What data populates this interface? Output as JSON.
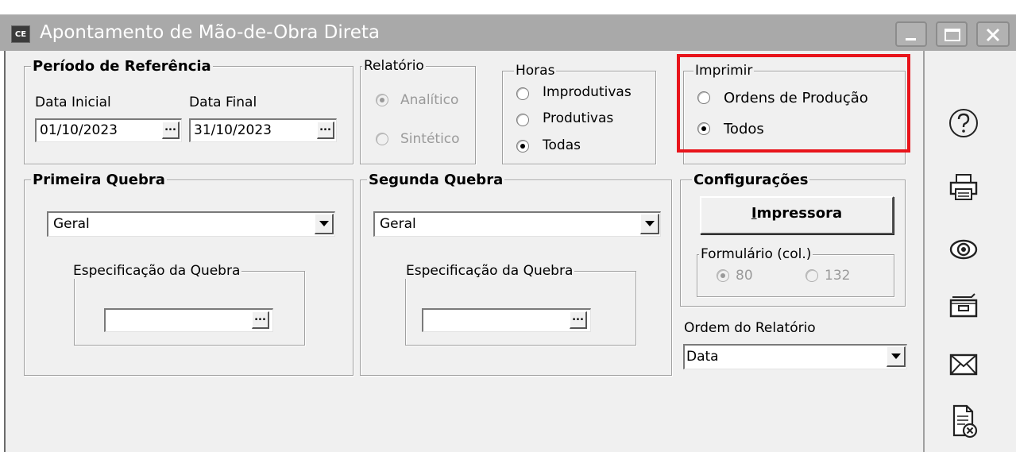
{
  "window": {
    "app_badge": "CE",
    "title": "Apontamento de Mão-de-Obra Direta"
  },
  "periodo": {
    "legend": "Período de Referência",
    "data_inicial_label": "Data Inicial",
    "data_final_label": "Data Final",
    "data_inicial_value": "01/10/2023",
    "data_final_value": "31/10/2023",
    "ellipsis": "..."
  },
  "relatorio": {
    "legend": "Relatório",
    "options": [
      "Analítico",
      "Sintético"
    ],
    "selected": "Analítico",
    "enabled": false
  },
  "horas": {
    "legend": "Horas",
    "options": [
      "Improdutivas",
      "Produtivas",
      "Todas"
    ],
    "selected": "Todas"
  },
  "imprimir": {
    "legend": "Imprimir",
    "options": [
      "Ordens de Produção",
      "Todos"
    ],
    "selected": "Todos"
  },
  "primeira_quebra": {
    "legend": "Primeira Quebra",
    "value": "Geral",
    "spec_legend": "Especificação da Quebra",
    "spec_value": ""
  },
  "segunda_quebra": {
    "legend": "Segunda Quebra",
    "value": "Geral",
    "spec_legend": "Especificação da Quebra",
    "spec_value": ""
  },
  "configuracoes": {
    "legend": "Configurações",
    "impressora_underline": "I",
    "impressora_rest": "mpressora",
    "formulario_legend": "Formulário (col.)",
    "formulario_options": [
      "80",
      "132"
    ],
    "formulario_selected": "80",
    "formulario_enabled": false
  },
  "ordem": {
    "label": "Ordem do Relatório",
    "value": "Data"
  },
  "side_icons": [
    "help-icon",
    "printer-icon",
    "preview-eye-icon",
    "file-drawer-icon",
    "email-envelope-icon",
    "document-cancel-icon"
  ],
  "colors": {
    "titlebar": "#a9a9a9",
    "window_bg": "#f0f0f0",
    "highlight": "#e8141b"
  }
}
